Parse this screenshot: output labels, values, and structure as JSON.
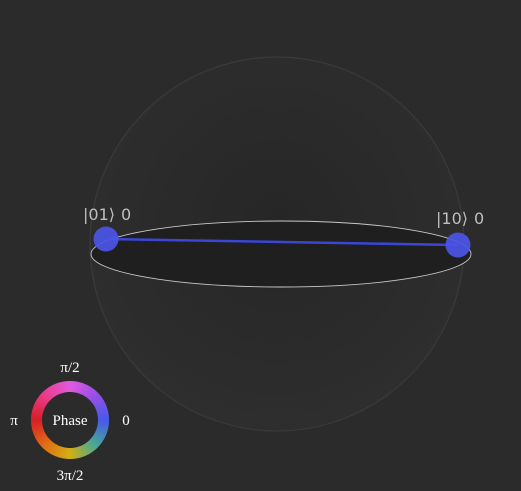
{
  "states": [
    {
      "ket": "|01⟩",
      "phase": "0",
      "color": "#4b55e6"
    },
    {
      "ket": "|10⟩",
      "phase": "0",
      "color": "#4b55e6"
    }
  ],
  "connector_color": "#3b46d6",
  "phase_wheel": {
    "center_label": "Phase",
    "top_label": "π/2",
    "left_label": "π",
    "right_label": "0",
    "bottom_label": "3π/2"
  },
  "colors": {
    "background": "#2b2b2b",
    "sphere_outline": "#3a3a3a",
    "equator": "#c8c8c8"
  }
}
